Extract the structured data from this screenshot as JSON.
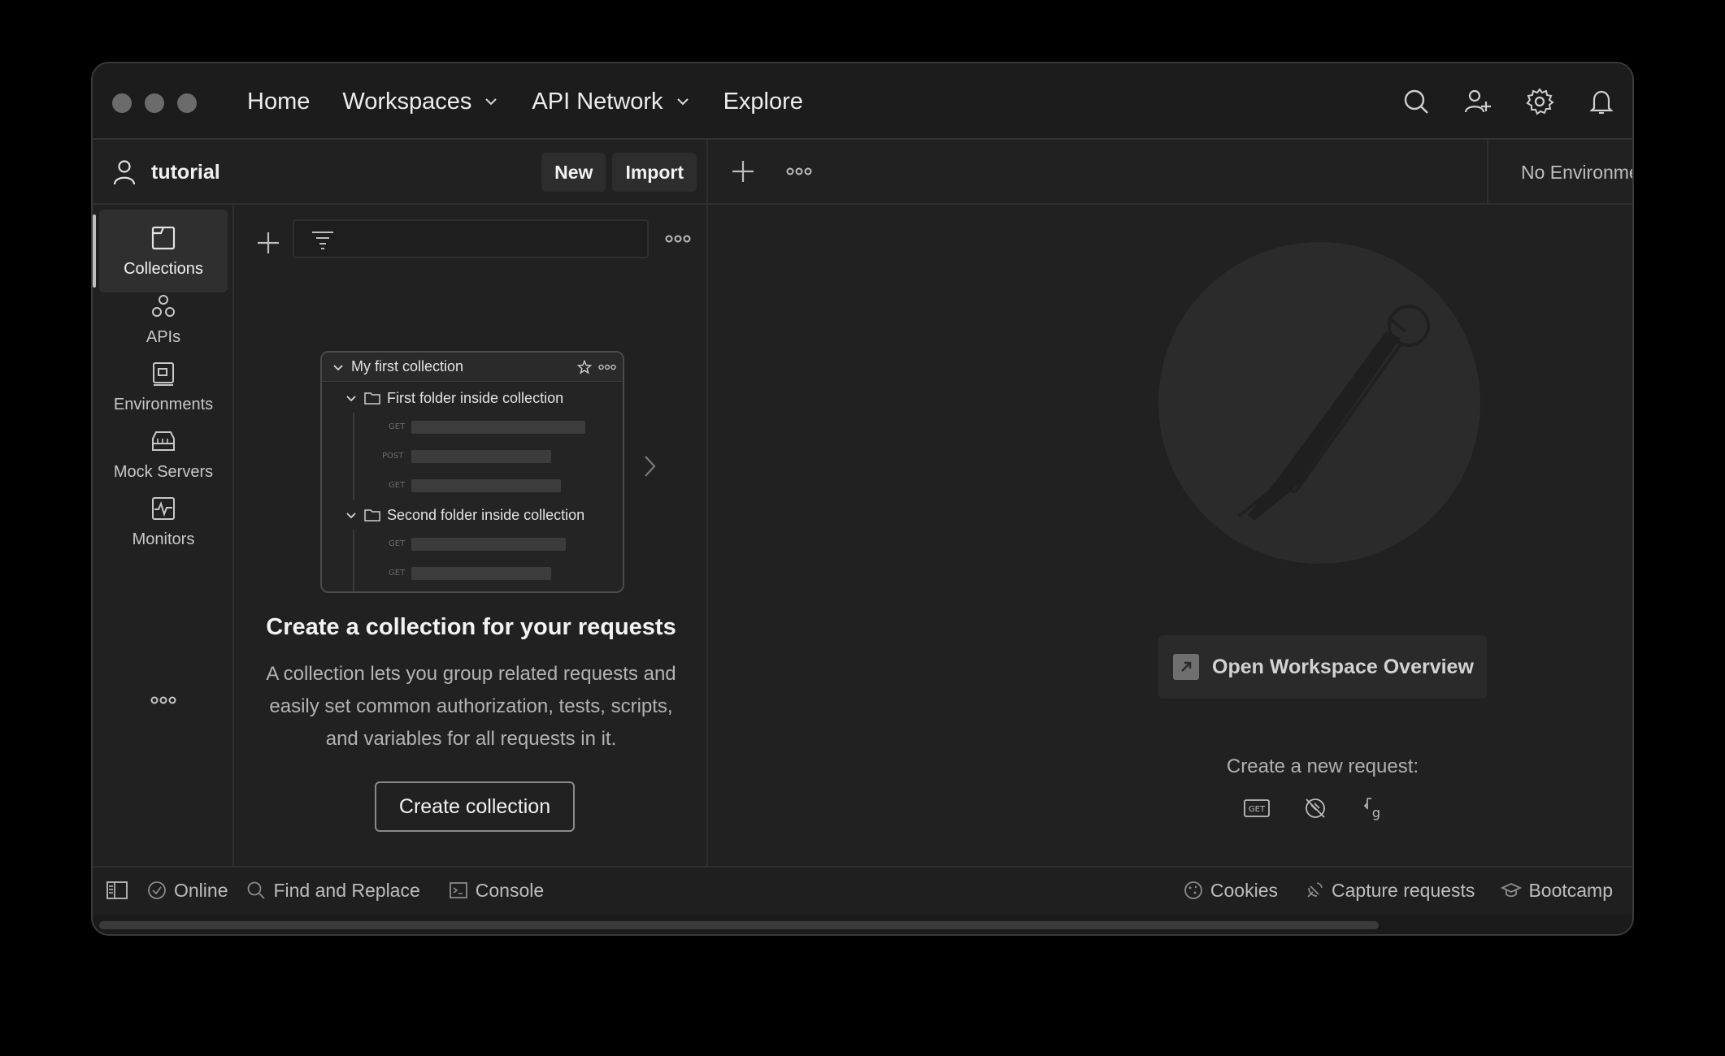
{
  "nav": {
    "home": "Home",
    "workspaces": "Workspaces",
    "api_network": "API Network",
    "explore": "Explore"
  },
  "workspace": {
    "name": "tutorial",
    "new_label": "New",
    "import_label": "Import"
  },
  "environment": {
    "selected": "No Environment"
  },
  "sidebar": {
    "items": [
      {
        "label": "Collections",
        "icon": "collections-icon",
        "active": true
      },
      {
        "label": "APIs",
        "icon": "apis-icon"
      },
      {
        "label": "Environments",
        "icon": "environments-icon"
      },
      {
        "label": "Mock Servers",
        "icon": "mock-servers-icon"
      },
      {
        "label": "Monitors",
        "icon": "monitors-icon"
      }
    ]
  },
  "preview": {
    "collection": "My first collection",
    "folder1": "First folder inside collection",
    "folder2": "Second folder inside collection",
    "methods": [
      "GET",
      "POST",
      "GET",
      "GET",
      "GET"
    ]
  },
  "empty_state": {
    "title": "Create a collection for your requests",
    "description": "A collection lets you group related requests and easily set common authorization, tests, scripts, and variables for all requests in it.",
    "button": "Create collection"
  },
  "main": {
    "overview_button": "Open Workspace Overview",
    "new_request_label": "Create a new request:"
  },
  "statusbar": {
    "online": "Online",
    "find_replace": "Find and Replace",
    "console": "Console",
    "cookies": "Cookies",
    "capture": "Capture requests",
    "bootcamp": "Bootcamp"
  },
  "colors": {
    "background": "#212121",
    "titlebar": "#1c1c1c",
    "text": "#e6e6e6",
    "muted": "#b3b3b3"
  }
}
